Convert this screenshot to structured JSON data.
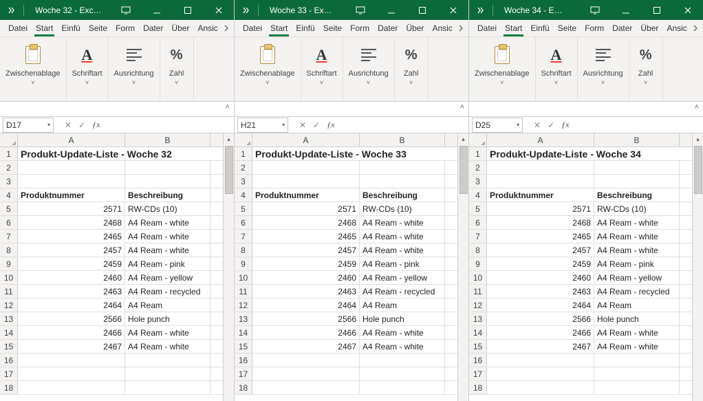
{
  "menus": [
    "Datei",
    "Start",
    "Einfü",
    "Seite",
    "Form",
    "Dater",
    "Über",
    "Ansic"
  ],
  "ribbon": {
    "clipboard": "Zwischenablage",
    "font": "Schriftart",
    "align": "Ausrichtung",
    "number": "Zahl",
    "drop": "˅"
  },
  "headers": {
    "colA": "A",
    "colB": "B"
  },
  "table_headers": {
    "num": "Produktnummer",
    "desc": "Beschreibung"
  },
  "products": [
    {
      "num": 2571,
      "desc": "RW-CDs (10)"
    },
    {
      "num": 2468,
      "desc": "A4 Ream - white"
    },
    {
      "num": 2465,
      "desc": "A4 Ream - white"
    },
    {
      "num": 2457,
      "desc": "A4 Ream - white"
    },
    {
      "num": 2459,
      "desc": "A4 Ream - pink"
    },
    {
      "num": 2460,
      "desc": "A4 Ream - yellow"
    },
    {
      "num": 2463,
      "desc": "A4 Ream - recycled"
    },
    {
      "num": 2464,
      "desc": "A4 Ream"
    },
    {
      "num": 2566,
      "desc": "Hole punch"
    },
    {
      "num": 2466,
      "desc": "A4 Ream - white"
    },
    {
      "num": 2467,
      "desc": "A4 Ream - white"
    }
  ],
  "windows": [
    {
      "title": "Woche 32  -  Exc…",
      "namebox": "D17",
      "sheet_title": "Produkt-Update-Liste - Woche 32"
    },
    {
      "title": "Woche 33  -  Ex…",
      "namebox": "H21",
      "sheet_title": "Produkt-Update-Liste - Woche 33"
    },
    {
      "title": "Woche 34  -  E…",
      "namebox": "D25",
      "sheet_title": "Produkt-Update-Liste - Woche 34"
    }
  ],
  "fx": "ƒx",
  "cancel": "✕",
  "accept": "✓",
  "collapse": "˄"
}
